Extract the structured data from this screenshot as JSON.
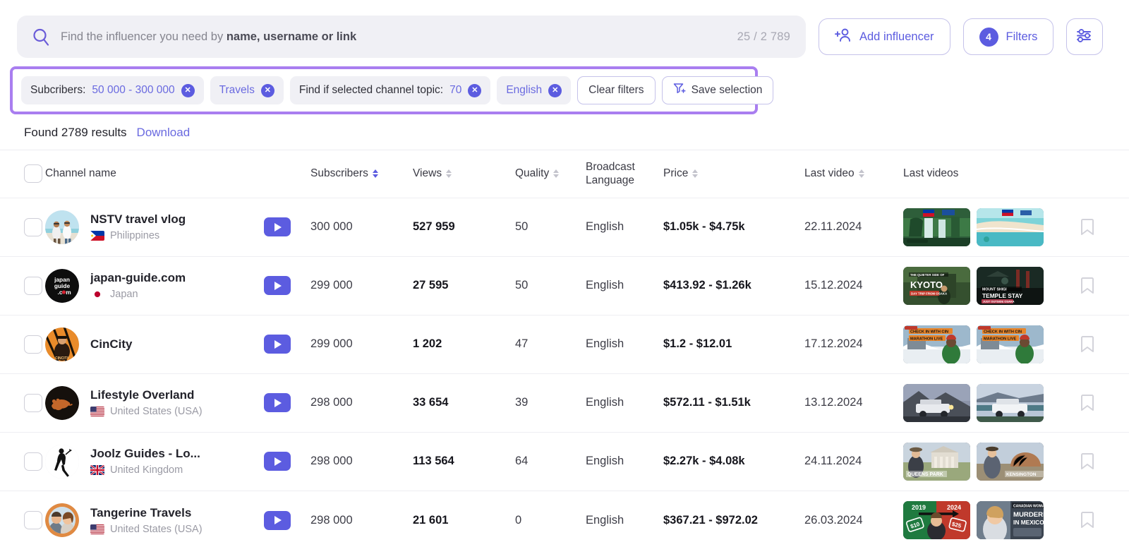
{
  "search": {
    "icon": "search-icon",
    "placeholder_prefix": "Find the influencer you need by ",
    "placeholder_bold": "name, username or link",
    "value": "",
    "count": "25 / 2 789"
  },
  "toolbar": {
    "add_influencer_label": "Add influencer",
    "add_influencer_icon": "add-user-icon",
    "filters_label": "Filters",
    "filters_count": "4",
    "settings_icon": "sliders-icon"
  },
  "filters": {
    "chips": [
      {
        "label": "Subcribers:",
        "value": "50 000 - 300 000",
        "removable": true,
        "style": "label-value"
      },
      {
        "label": "Travels",
        "value": "",
        "removable": true,
        "style": "accent"
      },
      {
        "label": "Find if selected channel topic:",
        "value": "70",
        "removable": true,
        "style": "label-value"
      },
      {
        "label": "English",
        "value": "",
        "removable": true,
        "style": "accent"
      }
    ],
    "clear_label": "Clear filters",
    "save_label": "Save selection",
    "save_icon": "funnel-plus-icon",
    "highlight_color": "#a97ef0"
  },
  "results": {
    "found_text": "Found 2789 results",
    "download_label": "Download"
  },
  "table": {
    "columns": [
      {
        "key": "check",
        "label": "",
        "sortable": false
      },
      {
        "key": "name",
        "label": "Channel name",
        "sortable": false
      },
      {
        "key": "yt",
        "label": "",
        "sortable": false
      },
      {
        "key": "subs",
        "label": "Subscribers",
        "sortable": true,
        "sort_active": "desc"
      },
      {
        "key": "views",
        "label": "Views",
        "sortable": true
      },
      {
        "key": "quality",
        "label": "Quality",
        "sortable": true
      },
      {
        "key": "language",
        "label": "Broadcast Language",
        "sortable": false
      },
      {
        "key": "price",
        "label": "Price",
        "sortable": true
      },
      {
        "key": "lastvid",
        "label": "Last video",
        "sortable": true
      },
      {
        "key": "lastvids",
        "label": "Last videos",
        "sortable": false
      },
      {
        "key": "bookmark",
        "label": "",
        "sortable": false
      }
    ],
    "rows": [
      {
        "checked": false,
        "name": "NSTV travel vlog",
        "country": "Philippines",
        "flag": "ph",
        "avatar": "beach-two-men",
        "subscribers": "300 000",
        "views": "527 959",
        "quality": "50",
        "language": "English",
        "price": "$1.05k - $4.75k",
        "last_video": "22.11.2024",
        "thumbs": [
          "waterfall-green",
          "beach-turquoise"
        ]
      },
      {
        "checked": false,
        "name": "japan-guide.com",
        "country": "Japan",
        "flag": "jp",
        "avatar": "japan-guide-logo",
        "subscribers": "299 000",
        "views": "27 595",
        "quality": "50",
        "language": "English",
        "price": "$413.92 - $1.26k",
        "last_video": "15.12.2024",
        "thumbs": [
          "kyoto-card",
          "temple-stay-card"
        ]
      },
      {
        "checked": false,
        "name": "CinCity",
        "country": "",
        "flag": "",
        "avatar": "cincity-orange",
        "subscribers": "299 000",
        "views": "1 202",
        "quality": "47",
        "language": "English",
        "price": "$1.2 - $12.01",
        "last_video": "17.12.2024",
        "thumbs": [
          "marathon-live-1",
          "marathon-live-2"
        ]
      },
      {
        "checked": false,
        "name": "Lifestyle Overland",
        "country": "United States (USA)",
        "flag": "us",
        "avatar": "bear-dark",
        "subscribers": "298 000",
        "views": "33 654",
        "quality": "39",
        "language": "English",
        "price": "$572.11 - $1.51k",
        "last_video": "13.12.2024",
        "thumbs": [
          "truck-mountain",
          "truck-lake"
        ]
      },
      {
        "checked": false,
        "name": "Joolz Guides - Lo...",
        "country": "United Kingdom",
        "flag": "gb",
        "avatar": "walking-man-silhouette",
        "subscribers": "298 000",
        "views": "113 564",
        "quality": "64",
        "language": "English",
        "price": "$2.27k - $4.08k",
        "last_video": "24.11.2024",
        "thumbs": [
          "queens-park",
          "south-kensington"
        ]
      },
      {
        "checked": false,
        "name": "Tangerine Travels",
        "country": "United States (USA)",
        "flag": "us",
        "avatar": "couple-orange-ring",
        "subscribers": "298 000",
        "views": "21 601",
        "quality": "0",
        "language": "English",
        "price": "$367.21 - $972.02",
        "last_video": "26.03.2024",
        "thumbs": [
          "price-2019-2024",
          "murdered-mexico"
        ]
      }
    ]
  },
  "colors": {
    "accent": "#5c5ce0",
    "accent_light": "#6a6ae0",
    "highlight": "#a97ef0",
    "chip_bg": "#f0f0f5",
    "text": "#23232b"
  }
}
